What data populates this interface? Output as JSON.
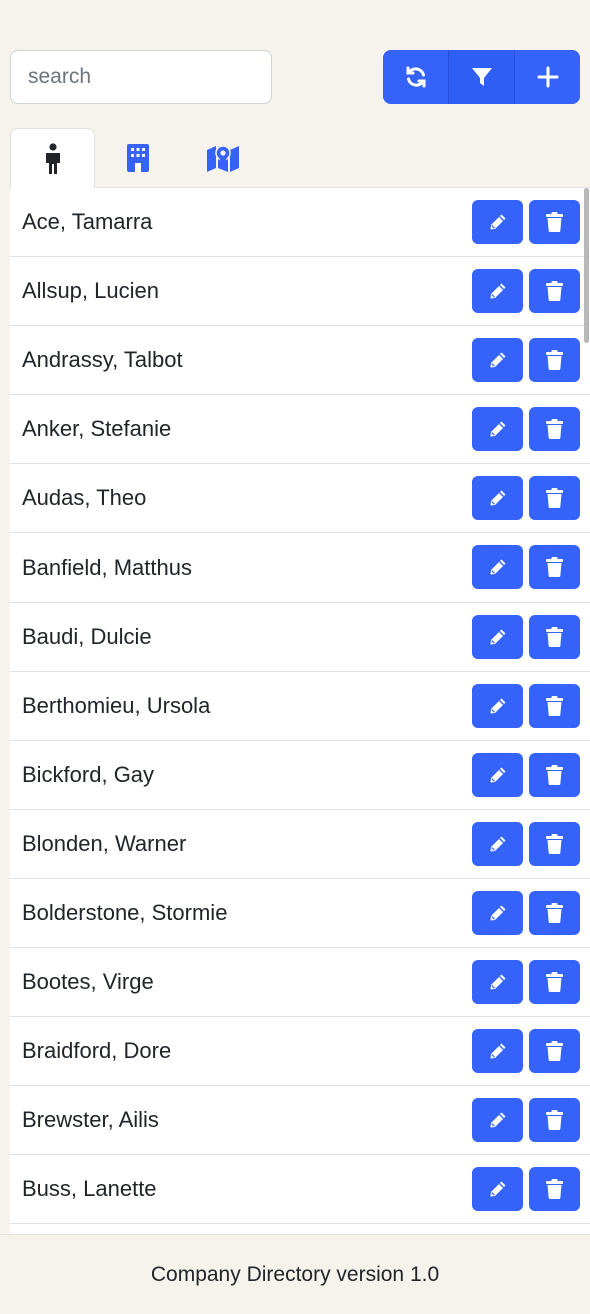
{
  "search": {
    "placeholder": "search",
    "value": ""
  },
  "toolbar": {
    "refresh_icon": "refresh-icon",
    "filter_icon": "filter-icon",
    "add_icon": "plus-icon"
  },
  "tabs": [
    {
      "icon": "person-icon",
      "active": true
    },
    {
      "icon": "building-icon",
      "active": false
    },
    {
      "icon": "map-pin-icon",
      "active": false
    }
  ],
  "colors": {
    "primary": "#3563fa",
    "background": "#f5f3ec",
    "border": "#dee2e6"
  },
  "list": {
    "rows": [
      {
        "name": "Ace, Tamarra"
      },
      {
        "name": "Allsup, Lucien"
      },
      {
        "name": "Andrassy, Talbot"
      },
      {
        "name": "Anker, Stefanie"
      },
      {
        "name": "Audas, Theo"
      },
      {
        "name": "Banfield, Matthus"
      },
      {
        "name": "Baudi, Dulcie"
      },
      {
        "name": "Berthomieu, Ursola"
      },
      {
        "name": "Bickford, Gay"
      },
      {
        "name": "Blonden, Warner"
      },
      {
        "name": "Bolderstone, Stormie"
      },
      {
        "name": "Bootes, Virge"
      },
      {
        "name": "Braidford, Dore"
      },
      {
        "name": "Brewster, Ailis"
      },
      {
        "name": "Buss, Lanette"
      }
    ]
  },
  "footer": {
    "text": "Company Directory version 1.0"
  }
}
